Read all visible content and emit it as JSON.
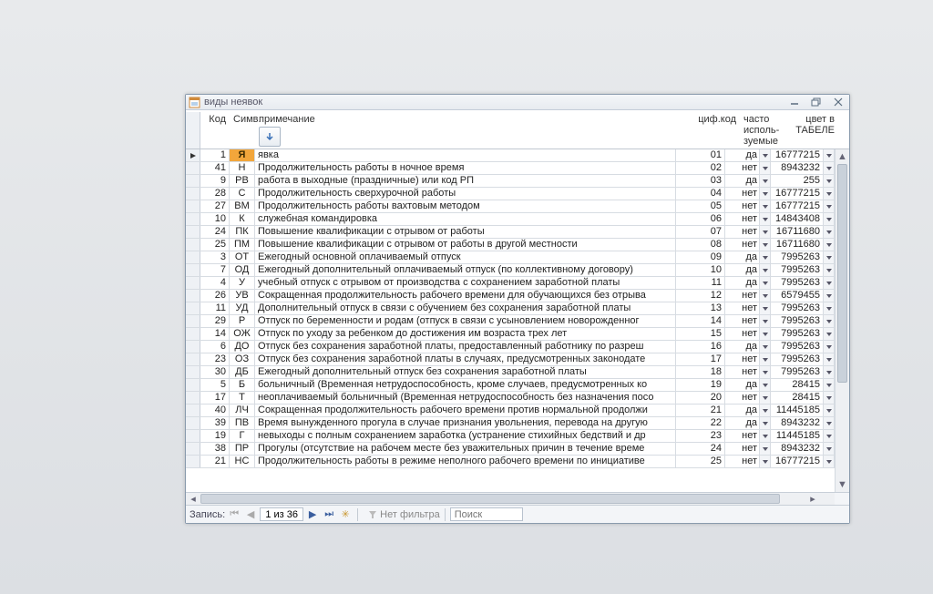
{
  "window": {
    "title": "виды неявок"
  },
  "headers": {
    "code": "Код",
    "simv": "Симв.",
    "note": "примечание",
    "cif": "циф.код",
    "freq": "часто исполь-зуемые",
    "color": "цвет в ТАБЕЛЕ"
  },
  "nav": {
    "label": "Запись:",
    "position": "1 из 36",
    "filter_label": "Нет фильтра",
    "search_placeholder": "Поиск"
  },
  "rows": [
    {
      "code": "1",
      "simv": "Я",
      "note": "явка",
      "cif": "01",
      "freq": "да",
      "color": "16777215",
      "sel": true,
      "hl": true
    },
    {
      "code": "41",
      "simv": "Н",
      "note": "Продолжительность работы в ночное время",
      "cif": "02",
      "freq": "нет",
      "color": "8943232"
    },
    {
      "code": "9",
      "simv": "РВ",
      "note": "работа в выходные (праздничные) или код РП",
      "cif": "03",
      "freq": "да",
      "color": "255"
    },
    {
      "code": "28",
      "simv": "С",
      "note": "Продолжительность сверхурочной работы",
      "cif": "04",
      "freq": "нет",
      "color": "16777215"
    },
    {
      "code": "27",
      "simv": "ВМ",
      "note": "Продолжительность работы вахтовым методом",
      "cif": "05",
      "freq": "нет",
      "color": "16777215"
    },
    {
      "code": "10",
      "simv": "К",
      "note": "служебная командировка",
      "cif": "06",
      "freq": "нет",
      "color": "14843408"
    },
    {
      "code": "24",
      "simv": "ПК",
      "note": "Повышение квалификации с отрывом от работы",
      "cif": "07",
      "freq": "нет",
      "color": "16711680"
    },
    {
      "code": "25",
      "simv": "ПМ",
      "note": "Повышение квалификации с отрывом от работы в другой местности",
      "cif": "08",
      "freq": "нет",
      "color": "16711680"
    },
    {
      "code": "3",
      "simv": "ОТ",
      "note": "Ежегодный основной оплачиваемый отпуск",
      "cif": "09",
      "freq": "да",
      "color": "7995263"
    },
    {
      "code": "7",
      "simv": "ОД",
      "note": "Ежегодный дополнительный оплачиваемый отпуск (по коллективному договору)",
      "cif": "10",
      "freq": "да",
      "color": "7995263"
    },
    {
      "code": "4",
      "simv": "У",
      "note": "учебный отпуск с отрывом от производства с сохранением заработной платы",
      "cif": "11",
      "freq": "да",
      "color": "7995263"
    },
    {
      "code": "26",
      "simv": "УВ",
      "note": "Сокращенная продолжительность рабочего времени для обучающихся без отрыва",
      "cif": "12",
      "freq": "нет",
      "color": "6579455"
    },
    {
      "code": "11",
      "simv": "УД",
      "note": "Дополнительный отпуск в связи с обучением без сохранения заработной платы",
      "cif": "13",
      "freq": "нет",
      "color": "7995263"
    },
    {
      "code": "29",
      "simv": "Р",
      "note": "Отпуск по беременности и родам (отпуск в связи с усыновлением новорожденног",
      "cif": "14",
      "freq": "нет",
      "color": "7995263"
    },
    {
      "code": "14",
      "simv": "ОЖ",
      "note": "Отпуск по уходу за ребенком до достижения им возраста трех лет",
      "cif": "15",
      "freq": "нет",
      "color": "7995263"
    },
    {
      "code": "6",
      "simv": "ДО",
      "note": "Отпуск без сохранения заработной платы, предоставленный работнику по разреш",
      "cif": "16",
      "freq": "да",
      "color": "7995263"
    },
    {
      "code": "23",
      "simv": "ОЗ",
      "note": "Отпуск без сохранения заработной платы в случаях, предусмотренных законодате",
      "cif": "17",
      "freq": "нет",
      "color": "7995263"
    },
    {
      "code": "30",
      "simv": "ДБ",
      "note": "Ежегодный дополнительный отпуск без сохранения заработной платы",
      "cif": "18",
      "freq": "нет",
      "color": "7995263"
    },
    {
      "code": "5",
      "simv": "Б",
      "note": "больничный (Временная нетрудоспособность, кроме случаев, предусмотренных ко",
      "cif": "19",
      "freq": "да",
      "color": "28415"
    },
    {
      "code": "17",
      "simv": "Т",
      "note": "неоплачиваемый больничный (Временная нетрудоспособность без назначения посо",
      "cif": "20",
      "freq": "нет",
      "color": "28415"
    },
    {
      "code": "40",
      "simv": "ЛЧ",
      "note": "Сокращенная продолжительность рабочего времени против нормальной продолжи",
      "cif": "21",
      "freq": "да",
      "color": "11445185"
    },
    {
      "code": "39",
      "simv": "ПВ",
      "note": "Время вынужденного прогула в случае признания увольнения, перевода на другую",
      "cif": "22",
      "freq": "да",
      "color": "8943232"
    },
    {
      "code": "19",
      "simv": "Г",
      "note": "невыходы с полным сохранением заработка (устранение стихийных бедствий и др",
      "cif": "23",
      "freq": "нет",
      "color": "11445185"
    },
    {
      "code": "38",
      "simv": "ПР",
      "note": "Прогулы (отсутствие на рабочем месте без уважительных причин в течение време",
      "cif": "24",
      "freq": "нет",
      "color": "8943232"
    },
    {
      "code": "21",
      "simv": "НС",
      "note": "Продолжительность работы в режиме неполного рабочего времени по инициативе",
      "cif": "25",
      "freq": "нет",
      "color": "16777215"
    }
  ]
}
